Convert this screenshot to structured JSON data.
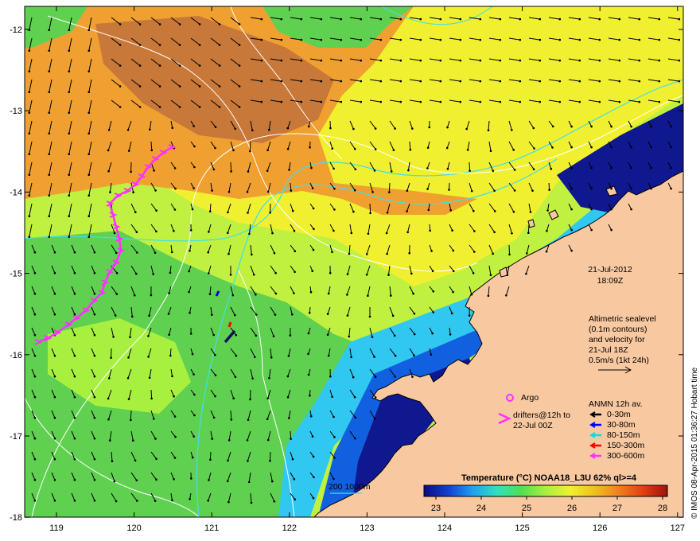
{
  "map": {
    "lon_ticks": [
      "119",
      "120",
      "121",
      "122",
      "123",
      "124",
      "125",
      "126",
      "127"
    ],
    "lat_ticks": [
      "-12",
      "-13",
      "-14",
      "-15",
      "-16",
      "-17",
      "-18"
    ],
    "colors": {
      "land": "#f8c8a0",
      "warm": "#f0a030",
      "hot": "#c87838",
      "yellow": "#f0f030",
      "lime": "#c0f040",
      "green": "#60d050",
      "cyan": "#30c8f0",
      "blue": "#1060e0",
      "navy": "#101890",
      "contour": "#ffffff",
      "isobath": "#40e0e8",
      "drifter": "#ff30ff"
    }
  },
  "annotations": {
    "date": "21-Jul-2012",
    "time": "18:09Z",
    "altimetry_lines": [
      "Altimetric sealevel",
      "(0.1m contours)",
      "and velocity for",
      "21-Jul 18Z",
      "0.5m/s (1kt 24h)"
    ],
    "argo_label": "Argo",
    "drifters_lines": [
      "drifters@12h to",
      "22-Jul 00Z"
    ],
    "anmn_title": "ANMN 12h av.",
    "anmn_depths": [
      {
        "label": "0-30m",
        "color": "#000000"
      },
      {
        "label": "30-80m",
        "color": "#0000ff"
      },
      {
        "label": "80-150m",
        "color": "#00e0e0"
      },
      {
        "label": "150-300m",
        "color": "#ff0000"
      },
      {
        "label": "300-600m",
        "color": "#ff30ff"
      }
    ],
    "isobath_label": "200  1000m",
    "credit": "© IMOS 08-Apr-2015 01:36:27 Hobart time"
  },
  "colorbar": {
    "title": "Temperature (°C) NOAA18_L3U 62% ql>=4",
    "ticks": [
      "23",
      "24",
      "25",
      "26",
      "27",
      "28"
    ],
    "stops": [
      "#0a0a80",
      "#1040d0",
      "#20a0f0",
      "#30e0c0",
      "#50e050",
      "#a8f040",
      "#f0f030",
      "#f0c020",
      "#f08020",
      "#e04010",
      "#a01010"
    ]
  }
}
